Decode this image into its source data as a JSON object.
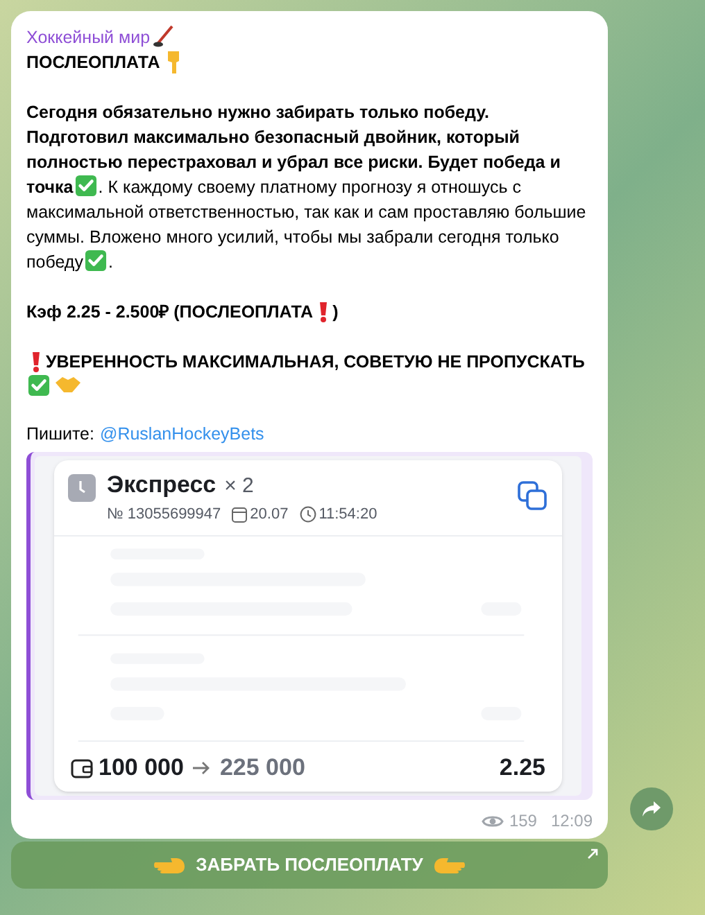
{
  "post": {
    "channel": "Хоккейный мир",
    "heading": "ПОСЛЕОПЛАТА",
    "body_bold": "Сегодня обязательно нужно забирать только победу. Подготовил максимально безопасный двойник, который полностью перестраховал и убрал все риски. Будет победа и точка",
    "body_regular": ". К каждому своему платному прогнозу я отношусь с максимальной ответственностью, так как и сам проставляю большие суммы. Вложено много усилий, чтобы мы забрали сегодня только победу",
    "body_end": ".",
    "odds": "Кэф 2.25 - 2.500₽ (ПОСЛЕОПЛАТА",
    "odds_close": ")",
    "confidence": "УВЕРЕННОСТЬ МАКСИМАЛЬНАЯ, СОВЕТУЮ НЕ ПРОПУСКАТЬ",
    "contact_label": "Пишите:",
    "contact_link": "@RuslanHockeyBets"
  },
  "bet_card": {
    "title": "Экспресс",
    "multiplier": "× 2",
    "number": "№ 13055699947",
    "date": "20.07",
    "time": "11:54:20",
    "stake": "100 000",
    "payout": "225 000",
    "odds": "2.25"
  },
  "meta": {
    "views": "159",
    "time": "12:09"
  },
  "action_button": {
    "label": "ЗАБРАТЬ ПОСЛЕОПЛАТУ"
  }
}
